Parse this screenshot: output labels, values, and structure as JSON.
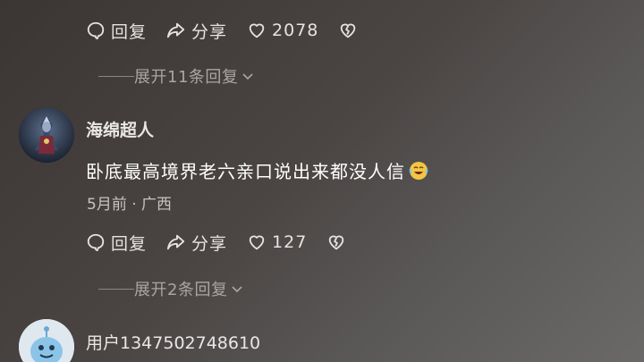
{
  "comment_top": {
    "reply_label": "回复",
    "share_label": "分享",
    "like_count": "2078",
    "icons": [
      "reply-icon",
      "share-icon",
      "heart-icon",
      "broken-heart-icon"
    ]
  },
  "expand_1": {
    "label": "展开11条回复"
  },
  "comment_2": {
    "username": "海绵超人",
    "text": "卧底最高境界老六亲口说出来都没人信",
    "emoji": "laughing-tears-emoji",
    "meta": "5月前 · 广西",
    "reply_label": "回复",
    "share_label": "分享",
    "like_count": "127"
  },
  "expand_2": {
    "label": "展开2条回复"
  },
  "comment_3": {
    "username": "用户1347502748610"
  },
  "colors": {
    "background_start": "#3b3533",
    "background_end": "#6b6968",
    "muted": "#a9a5a4"
  }
}
